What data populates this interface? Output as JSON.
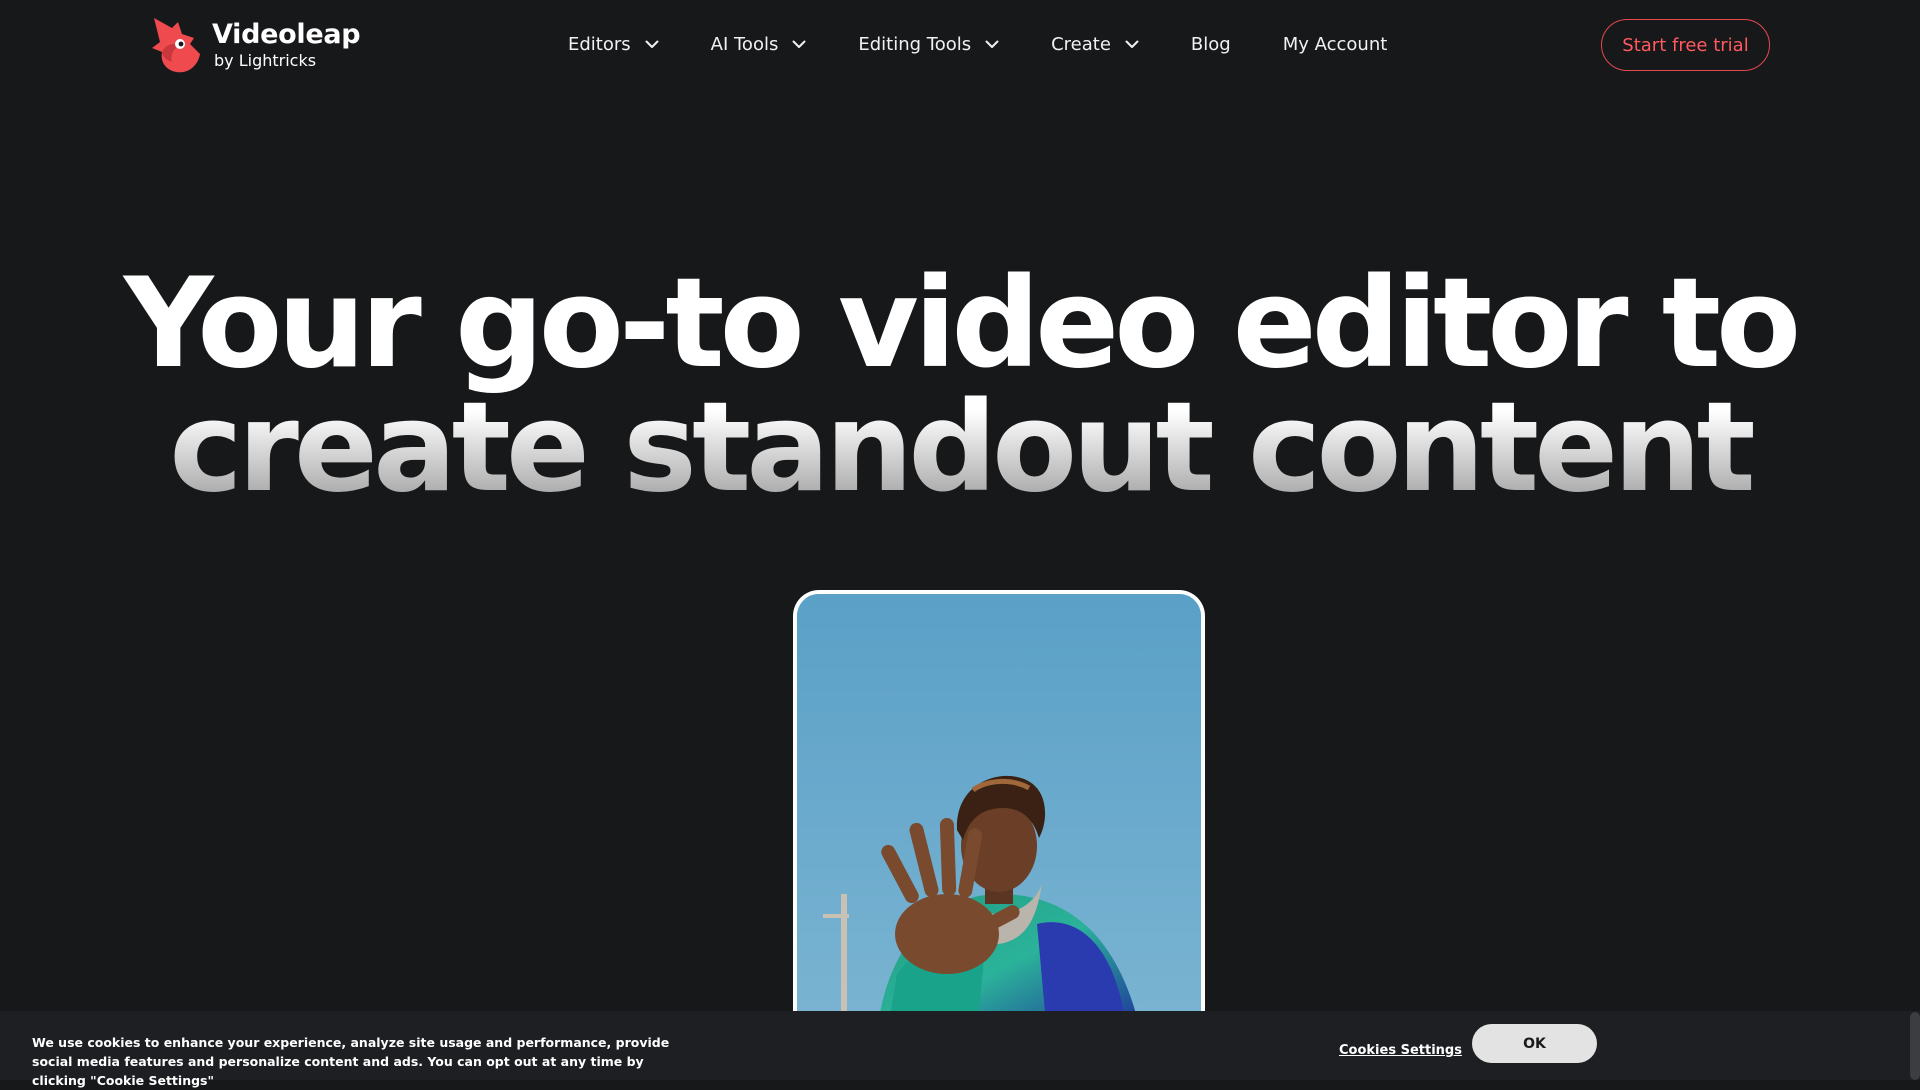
{
  "header": {
    "logo": {
      "name": "Videoleap",
      "sub": "by Lightricks",
      "icon": "videoleap-bird-logo",
      "color": "#ef4b4f"
    },
    "nav": [
      {
        "label": "Editors",
        "dropdown": true
      },
      {
        "label": "AI Tools",
        "dropdown": true
      },
      {
        "label": "Editing Tools",
        "dropdown": true
      },
      {
        "label": "Create",
        "dropdown": true
      },
      {
        "label": "Blog",
        "dropdown": false
      },
      {
        "label": "My Account",
        "dropdown": false
      }
    ],
    "cta": {
      "label": "Start free trial",
      "color": "#e5484d"
    }
  },
  "hero": {
    "line1": "Your go-to video editor to",
    "line2": "create standout content"
  },
  "cookie": {
    "text": "We use cookies to enhance your experience, analyze site usage and performance, provide social media features and personalize content and ads. You can opt out at any time by clicking \"Cookie Settings\"",
    "settings_label": "Cookies Settings",
    "ok_label": "OK"
  },
  "colors": {
    "background": "#17181a",
    "accent": "#ef4b4f",
    "cookie_bar": "#1d1f22"
  }
}
